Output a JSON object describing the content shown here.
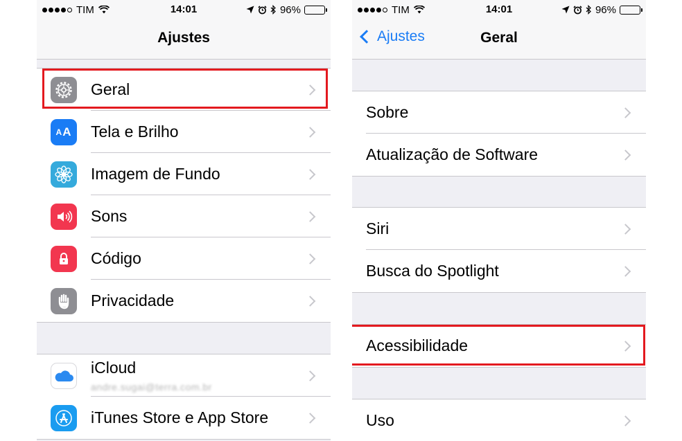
{
  "status_bar": {
    "carrier": "TIM",
    "time": "14:01",
    "battery": "96%",
    "battery_level": 0.96
  },
  "left": {
    "title": "Ajustes",
    "groups": [
      {
        "rows": [
          {
            "label": "Geral",
            "icon": "gear-icon",
            "color": "#8e8e93"
          },
          {
            "label": "Tela e Brilho",
            "icon": "text-size-icon",
            "color": "#1a7cf5"
          },
          {
            "label": "Imagem de Fundo",
            "icon": "flower-icon",
            "color": "#35aadc"
          },
          {
            "label": "Sons",
            "icon": "speaker-icon",
            "color": "#f2364f"
          },
          {
            "label": "Código",
            "icon": "lock-icon",
            "color": "#f2364f"
          },
          {
            "label": "Privacidade",
            "icon": "hand-icon",
            "color": "#8e8e93"
          }
        ]
      },
      {
        "rows": [
          {
            "label": "iCloud",
            "sublabel": "andre.sugai@terra.com.br",
            "icon": "cloud-icon",
            "color": "#ffffff"
          },
          {
            "label": "iTunes Store e App Store",
            "icon": "app-store-icon",
            "color": "#1a9cf0"
          }
        ]
      }
    ]
  },
  "right": {
    "back_label": "Ajustes",
    "title": "Geral",
    "groups": [
      {
        "rows": [
          {
            "label": "Sobre"
          },
          {
            "label": "Atualização de Software"
          }
        ]
      },
      {
        "rows": [
          {
            "label": "Siri"
          },
          {
            "label": "Busca do Spotlight"
          }
        ]
      },
      {
        "rows": [
          {
            "label": "Acessibilidade"
          }
        ]
      },
      {
        "rows": [
          {
            "label": "Uso"
          }
        ]
      }
    ]
  },
  "highlight_color": "#e3191f"
}
